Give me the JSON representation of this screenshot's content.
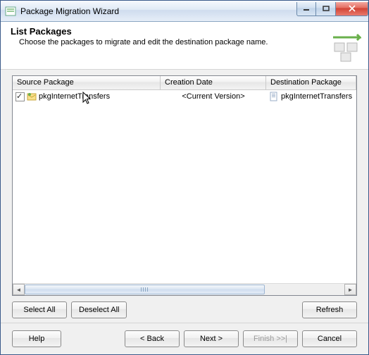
{
  "window": {
    "title": "Package Migration Wizard"
  },
  "header": {
    "title": "List Packages",
    "subtitle": "Choose the packages to migrate and edit the destination package name."
  },
  "grid": {
    "columns": {
      "source": "Source Package",
      "creation": "Creation Date",
      "destination": "Destination Package"
    },
    "row": {
      "checked": true,
      "sourceName": "pkgInternetTransfers",
      "creationDate": "<Current Version>",
      "destinationName": "pkgInternetTransfers"
    }
  },
  "buttons": {
    "selectAll": "Select All",
    "deselectAll": "Deselect All",
    "refresh": "Refresh",
    "help": "Help",
    "back": "< Back",
    "next": "Next >",
    "finish": "Finish >>|",
    "cancel": "Cancel"
  }
}
